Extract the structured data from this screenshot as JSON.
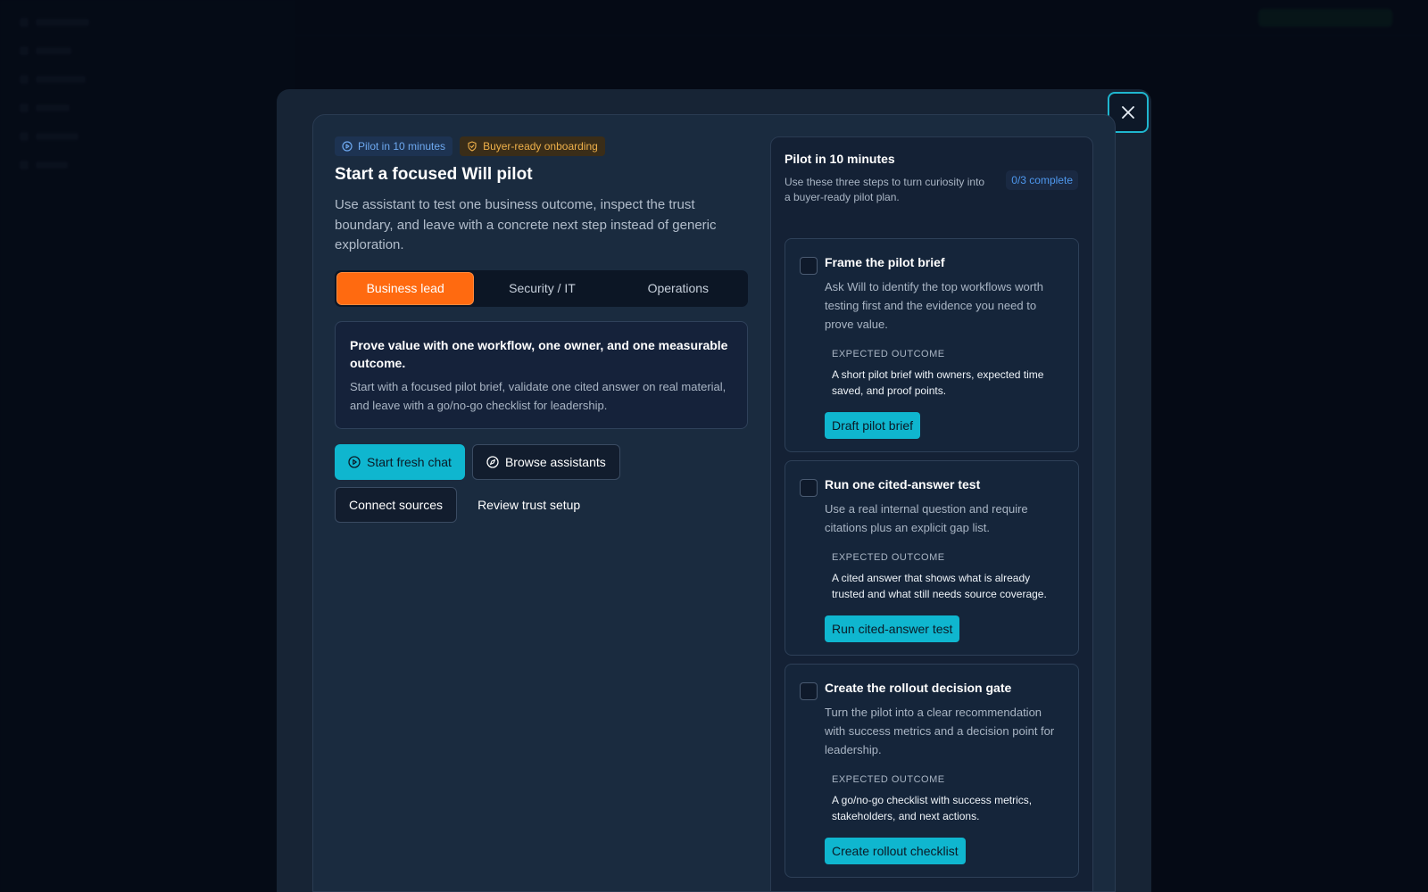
{
  "modal": {
    "badges": {
      "pilot": "Pilot in 10 minutes",
      "onboarding": "Buyer-ready onboarding"
    },
    "title": "Start a focused Will pilot",
    "description": "Use assistant to test one business outcome, inspect the trust boundary, and leave with a concrete next step instead of generic exploration.",
    "roles": [
      "Business lead",
      "Security / IT",
      "Operations"
    ],
    "active_role": "Business lead",
    "role_card": {
      "title": "Prove value with one workflow, one owner, and one measurable outcome.",
      "body": "Start with a focused pilot brief, validate one cited answer on real material, and leave with a go/no-go checklist for leadership."
    },
    "actions": {
      "start_chat": "Start fresh chat",
      "browse": "Browse assistants",
      "connect": "Connect sources",
      "review": "Review trust setup"
    }
  },
  "checklist": {
    "title": "Pilot in 10 minutes",
    "subtitle": "Use these three steps to turn curiosity into a buyer-ready pilot plan.",
    "progress": "0/3 complete",
    "expected_label": "EXPECTED OUTCOME",
    "steps": [
      {
        "title": "Frame the pilot brief",
        "description": "Ask Will to identify the top workflows worth testing first and the evidence you need to prove value.",
        "expected": "A short pilot brief with owners, expected time saved, and proof points.",
        "button": "Draft pilot brief",
        "checked": false
      },
      {
        "title": "Run one cited-answer test",
        "description": "Use a real internal question and require citations plus an explicit gap list.",
        "expected": "A cited answer that shows what is already trusted and what still needs source coverage.",
        "button": "Run cited-answer test",
        "checked": false
      },
      {
        "title": "Create the rollout decision gate",
        "description": "Turn the pilot into a clear recommendation with success metrics and a decision point for leadership.",
        "expected": "A go/no-go checklist with success metrics, stakeholders, and next actions.",
        "button": "Create rollout checklist",
        "checked": false
      }
    ]
  },
  "icons": {
    "close": "close-icon",
    "play": "play-circle-icon",
    "shield": "shield-check-icon",
    "compass": "compass-icon"
  },
  "colors": {
    "accent": "#0fb6cf",
    "active_tab": "#ff6a10",
    "badge_blue": "#6ea9f0",
    "badge_amber": "#eeb04a"
  }
}
